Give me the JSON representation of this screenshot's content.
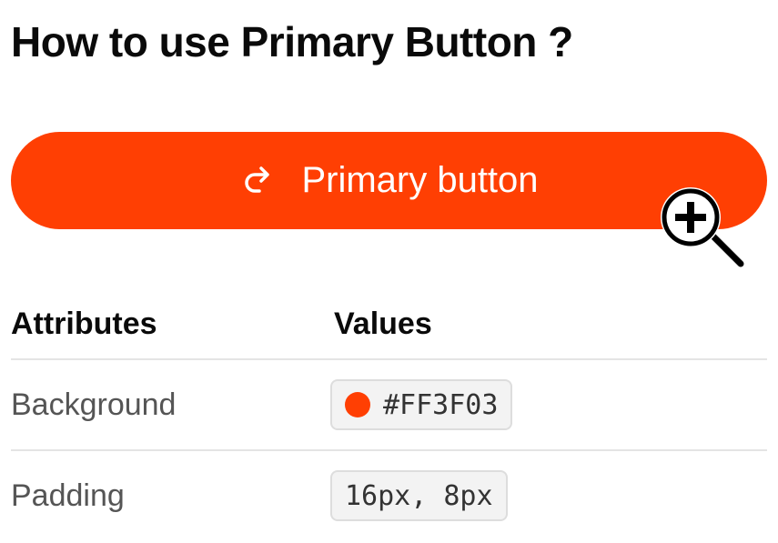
{
  "page": {
    "title": "How to use Primary Button ?"
  },
  "demo_button": {
    "label": "Primary button",
    "icon": "redo-icon",
    "background": "#FF3F03",
    "text_color": "#FFFFFF"
  },
  "overlay": {
    "icon": "zoom-in-icon"
  },
  "table": {
    "headers": [
      "Attributes",
      "Values"
    ],
    "rows": [
      {
        "attribute": "Background",
        "value": "#FF3F03",
        "swatch": "#FF3F03"
      },
      {
        "attribute": "Padding",
        "value": "16px, 8px"
      }
    ]
  }
}
